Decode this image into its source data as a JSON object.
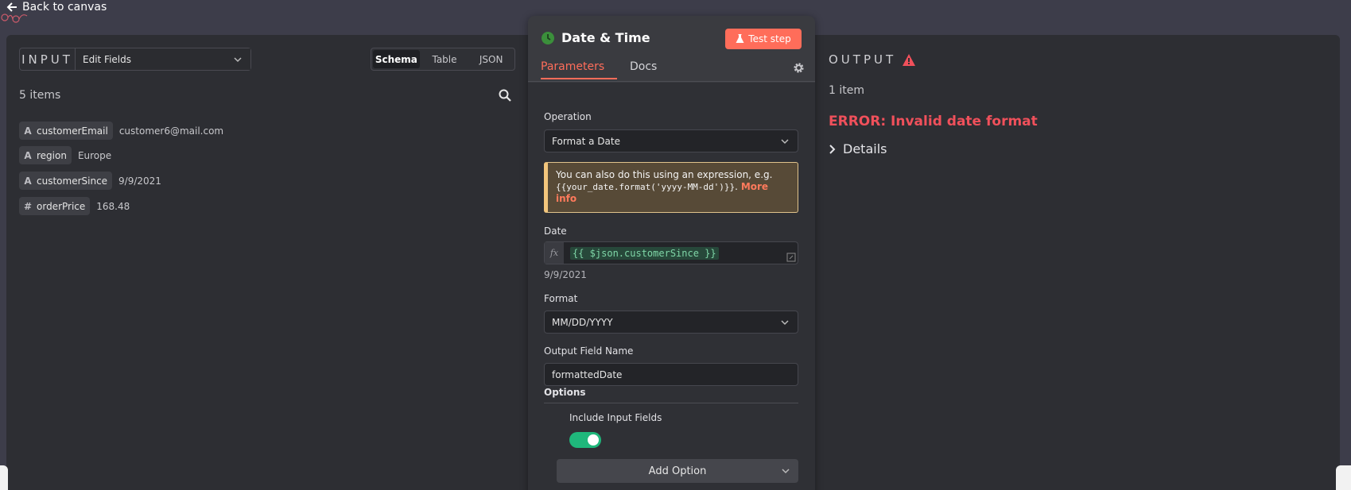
{
  "nav": {
    "back_label": "Back to canvas"
  },
  "input": {
    "label": "INPUT",
    "node_select": "Edit Fields",
    "views": [
      "Schema",
      "Table",
      "JSON"
    ],
    "active_view": "Schema",
    "items_count": "5 items",
    "fields": [
      {
        "type": "A",
        "name": "customerEmail",
        "value": "customer6@mail.com"
      },
      {
        "type": "A",
        "name": "region",
        "value": "Europe"
      },
      {
        "type": "A",
        "name": "customerSince",
        "value": "9/9/2021"
      },
      {
        "type": "#",
        "name": "orderPrice",
        "value": "168.48"
      }
    ]
  },
  "node": {
    "title": "Date & Time",
    "test_step_label": "Test step",
    "tabs": [
      "Parameters",
      "Docs"
    ],
    "operation_label": "Operation",
    "operation_value": "Format a Date",
    "notice_text": "You can also do this using an expression, e.g.",
    "notice_code": "{{your_date.format('yyyy-MM-dd')}}",
    "notice_punct": ".",
    "notice_link": "More info",
    "date_label": "Date",
    "fx_label": "fx",
    "date_expression": "{{ $json.customerSince }}",
    "date_preview": "9/9/2021",
    "format_label": "Format",
    "format_value": "MM/DD/YYYY",
    "output_field_label": "Output Field Name",
    "output_field_value": "formattedDate",
    "options_label": "Options",
    "include_input_label": "Include Input Fields",
    "include_input_on": true,
    "add_option_label": "Add Option"
  },
  "output": {
    "label": "OUTPUT",
    "items_count": "1 item",
    "error_text": "ERROR: Invalid date format",
    "details_label": "Details"
  },
  "colors": {
    "accent": "#ff6d5a",
    "error": "#f0505b",
    "toggle_on": "#1fb77b"
  }
}
